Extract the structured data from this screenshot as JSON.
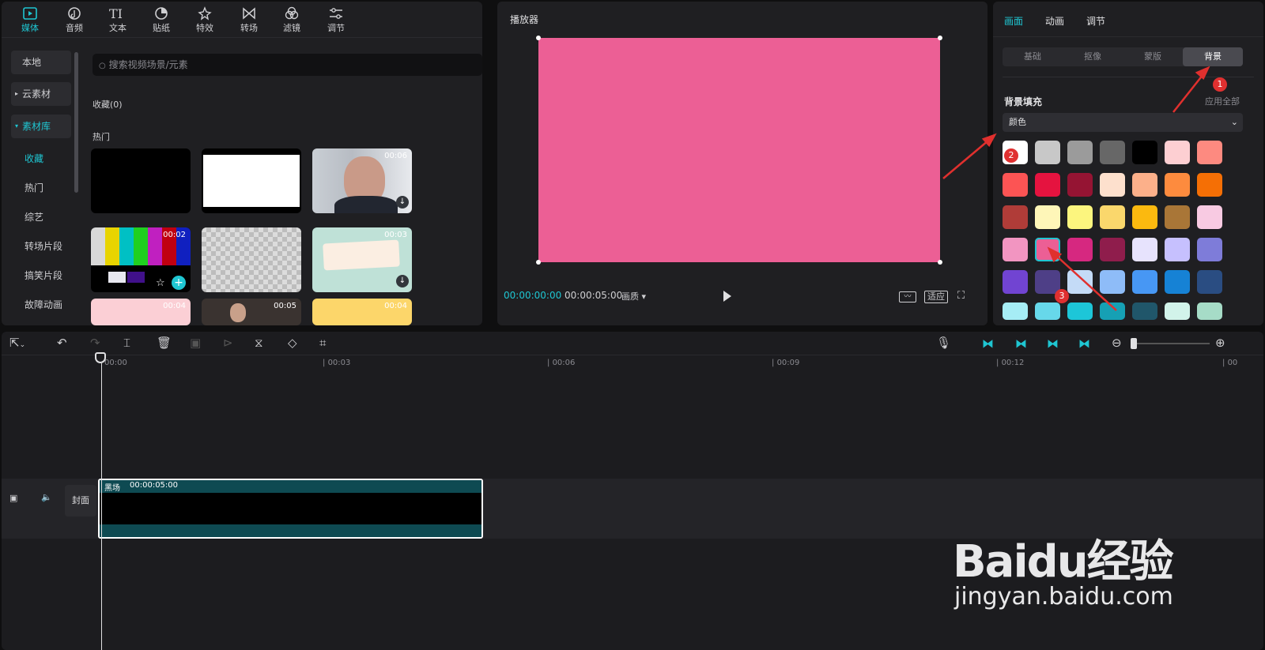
{
  "media_tabs": [
    {
      "label": "媒体",
      "icon": "media-icon"
    },
    {
      "label": "音频",
      "icon": "audio-icon"
    },
    {
      "label": "文本",
      "icon": "text-icon"
    },
    {
      "label": "贴纸",
      "icon": "sticker-icon"
    },
    {
      "label": "特效",
      "icon": "effects-icon"
    },
    {
      "label": "转场",
      "icon": "transition-icon"
    },
    {
      "label": "滤镜",
      "icon": "filter-icon"
    },
    {
      "label": "调节",
      "icon": "adjust-icon"
    }
  ],
  "sidebar": {
    "local": "本地",
    "cloud": "云素材",
    "library": "素材库",
    "subitems": [
      "收藏",
      "热门",
      "综艺",
      "转场片段",
      "搞笑片段",
      "故障动画"
    ]
  },
  "search": {
    "placeholder": "搜索视频场景/元素"
  },
  "sections": {
    "favorites": "收藏(0)",
    "hot": "热门"
  },
  "thumbs": [
    {
      "name": "black",
      "time": ""
    },
    {
      "name": "white",
      "time": ""
    },
    {
      "name": "man",
      "time": "00:06"
    },
    {
      "name": "colorbars",
      "time": "00:02"
    },
    {
      "name": "transparent",
      "time": ""
    },
    {
      "name": "paper",
      "time": "00:03"
    },
    {
      "name": "pink-partial",
      "time": "00:04"
    },
    {
      "name": "people-partial",
      "time": "00:05"
    },
    {
      "name": "yellow-partial",
      "time": "00:04"
    }
  ],
  "player": {
    "title": "播放器",
    "current_time": "00:00:00:00",
    "total_time": "00:00:05:00",
    "quality": "画质",
    "fit": "适应",
    "canvas_color": "#ec5f95"
  },
  "inspector": {
    "tabs": [
      "画面",
      "动画",
      "调节"
    ],
    "subtabs": [
      "基础",
      "抠像",
      "蒙版",
      "背景"
    ],
    "fill_label": "背景填充",
    "apply_all": "应用全部",
    "fill_type": "颜色",
    "colors": [
      [
        "#ffffff",
        "#c8c8c8",
        "#9b9b9b",
        "#676767",
        "#000000",
        "#fdcfd2",
        "#fd8a80"
      ],
      [
        "#fc5454",
        "#e5133f",
        "#951433",
        "#fde0cd",
        "#fcb08a",
        "#fd8b3e",
        "#f56f05"
      ],
      [
        "#b03c38",
        "#fef6b8",
        "#fcf57e",
        "#fad76c",
        "#fbb90f",
        "#a97637",
        "#f8cae2"
      ],
      [
        "#f295c1",
        "#ec5f95",
        "#d62880",
        "#8f1d4c",
        "#e7e3fd",
        "#c6c0fe",
        "#7e7cd9"
      ],
      [
        "#7144d2",
        "#4e3f87",
        "#c4dbf7",
        "#8ebcf8",
        "#4797f4",
        "#1682d5",
        "#2a4d82"
      ],
      [
        "#a6edf5",
        "#67d8ea",
        "#1dc6d8",
        "#16a0b4",
        "#20566a",
        "#d2f3ea",
        "#a6dcc7"
      ]
    ],
    "selected_color": "#ec5f95"
  },
  "annotations": [
    "1",
    "2",
    "3"
  ],
  "timeline": {
    "ruler": [
      "00:00",
      "00:03",
      "00:06",
      "00:09",
      "00:12",
      "00"
    ],
    "clip_name": "黑场",
    "clip_duration": "00:00:05:00",
    "cover": "封面"
  },
  "watermark": {
    "brand": "Baidu经验",
    "url": "jingyan.baidu.com"
  }
}
